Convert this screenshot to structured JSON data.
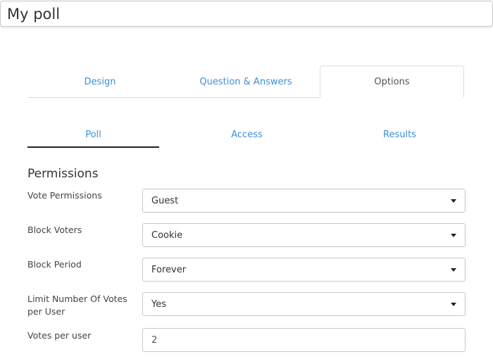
{
  "poll": {
    "title": "My poll"
  },
  "tabs": [
    {
      "label": "Design"
    },
    {
      "label": "Question & Answers"
    },
    {
      "label": "Options"
    }
  ],
  "subtabs": [
    {
      "label": "Poll"
    },
    {
      "label": "Access"
    },
    {
      "label": "Results"
    }
  ],
  "permissions": {
    "title": "Permissions",
    "vote_permissions": {
      "label": "Vote Permissions",
      "value": "Guest"
    },
    "block_voters": {
      "label": "Block Voters",
      "value": "Cookie"
    },
    "block_period": {
      "label": "Block Period",
      "value": "Forever"
    },
    "limit_votes": {
      "label": "Limit Number Of Votes per User",
      "value": "Yes"
    },
    "votes_per_user": {
      "label": "Votes per user",
      "value": "2"
    }
  },
  "colors": {
    "link": "#3d8fd6",
    "active_underline": "#222222",
    "border": "#c8c8c8"
  }
}
